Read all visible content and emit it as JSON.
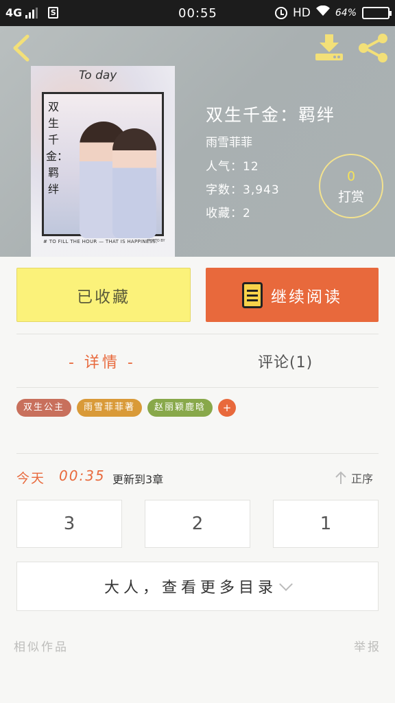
{
  "status_bar": {
    "network": "4G",
    "time": "00:55",
    "hd": "HD",
    "battery_text": "64%",
    "battery_level": 0.64
  },
  "book": {
    "title": "双生千金：羁绊",
    "author": "雨雪菲菲",
    "popularity": "人气：12",
    "word_count": "字数：3,943",
    "favorites": "收藏：2",
    "cover": {
      "header_text": "To day",
      "vertical_title": "双生千金：羁绊",
      "caption": "# TO FILL THE HOUR — THAT IS HAPPINESS.",
      "credit": "PHOTO BY"
    }
  },
  "tip": {
    "count": "0",
    "label": "打赏"
  },
  "actions": {
    "collected": "已收藏",
    "continue_reading": "继续阅读"
  },
  "tabs": {
    "details": "- 详情 -",
    "comments": "评论(1)"
  },
  "tags": [
    {
      "label": "双生公主",
      "color": "#c8705c"
    },
    {
      "label": "雨雪菲菲著",
      "color": "#d99a38"
    },
    {
      "label": "赵丽颖鹿晗",
      "color": "#88a84a"
    }
  ],
  "tag_add": "+",
  "update": {
    "today": "今天",
    "time": "00:35",
    "text": "更新到3章",
    "sort": "正序"
  },
  "chapters": [
    "3",
    "2",
    "1"
  ],
  "more_catalog": "大人，查看更多目录",
  "footer": {
    "similar": "相似作品",
    "report": "举报"
  },
  "colors": {
    "accent": "#e8693c",
    "collected": "#fbf27a",
    "tip_count": "#f5e25a"
  }
}
